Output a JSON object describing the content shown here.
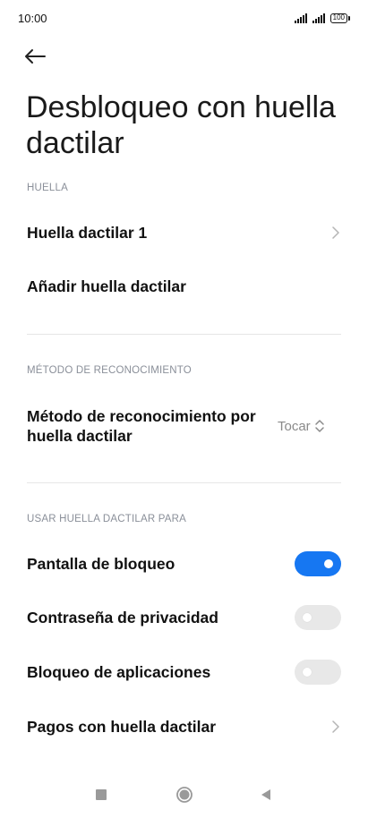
{
  "status_bar": {
    "time": "10:00",
    "battery": "100"
  },
  "header": {
    "title": "Desbloqueo con huella dactilar"
  },
  "sections": {
    "fingerprint": {
      "header": "HUELLA",
      "items": [
        {
          "label": "Huella dactilar 1"
        },
        {
          "label": "Añadir huella dactilar"
        }
      ]
    },
    "recognition": {
      "header": "MÉTODO DE RECONOCIMIENTO",
      "method_label": "Método de reconocimiento por huella dactilar",
      "method_value": "Tocar"
    },
    "usage": {
      "header": "USAR HUELLA DACTILAR PARA",
      "items": [
        {
          "label": "Pantalla de bloqueo",
          "enabled": true
        },
        {
          "label": "Contraseña de privacidad",
          "enabled": false
        },
        {
          "label": "Bloqueo de aplicaciones",
          "enabled": false
        },
        {
          "label": "Pagos con huella dactilar"
        }
      ]
    }
  },
  "icons": {
    "back": "back-arrow-icon",
    "chevron": "chevron-right-icon",
    "updown": "up-down-chevron-icon",
    "nav_recent": "square-icon",
    "nav_home": "circle-icon",
    "nav_back": "triangle-left-icon"
  },
  "colors": {
    "accent": "#1677f2",
    "toggle_off": "#e8e8e8",
    "section_header": "#8a8f99"
  }
}
